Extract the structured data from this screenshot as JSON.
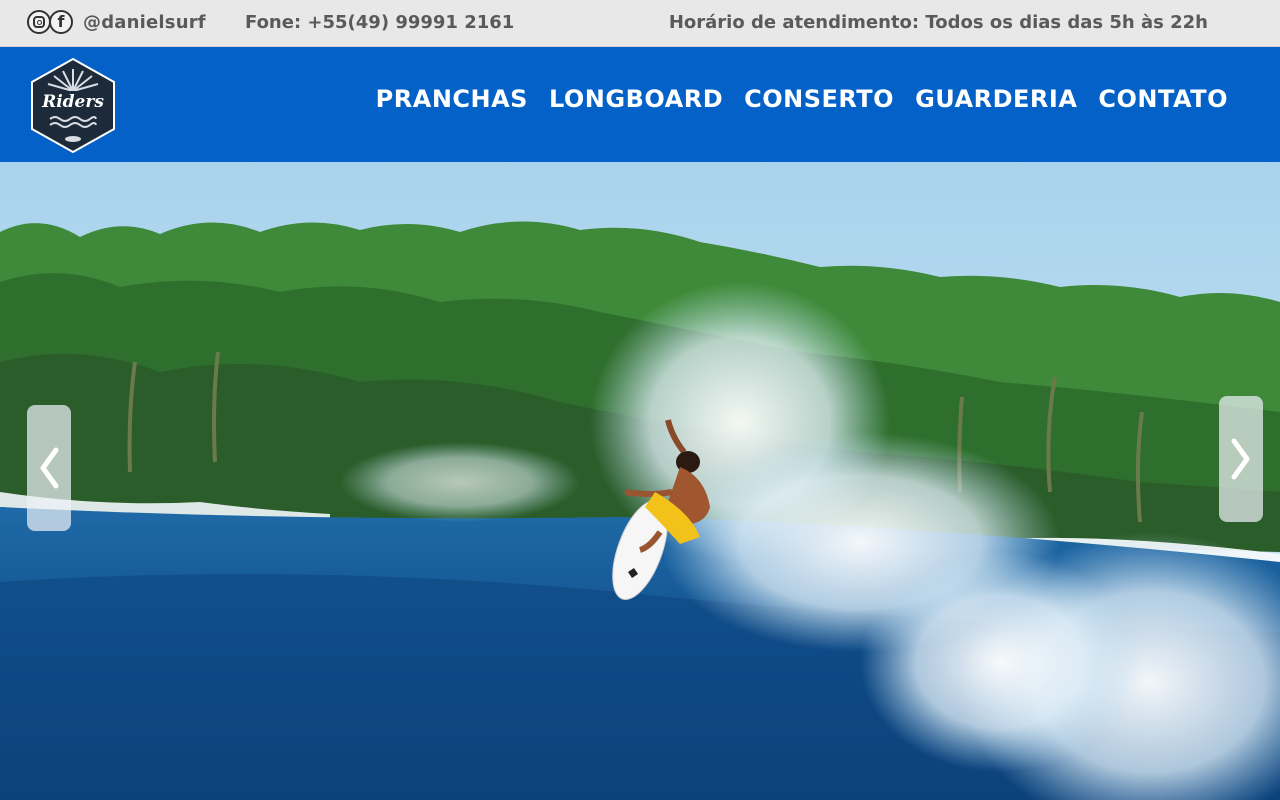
{
  "topbar": {
    "instagram_icon": "instagram-icon",
    "facebook_icon": "facebook-icon",
    "handle": "@danielsurf",
    "phone": "Fone: +55(49) 99991 2161",
    "hours": "Horário de atendimento: Todos os dias das 5h às 22h"
  },
  "header": {
    "logo_text": "Riders",
    "nav": [
      {
        "label": "PRANCHAS"
      },
      {
        "label": "LONGBOARD"
      },
      {
        "label": "CONSERTO"
      },
      {
        "label": "GUARDERIA"
      },
      {
        "label": "CONTATO"
      }
    ]
  },
  "slider": {
    "prev_icon": "chevron-left-icon",
    "next_icon": "chevron-right-icon"
  },
  "colors": {
    "topbar_bg": "#e8e8e8",
    "header_bg": "#0461c8",
    "text_gray": "#5a5a5a"
  }
}
